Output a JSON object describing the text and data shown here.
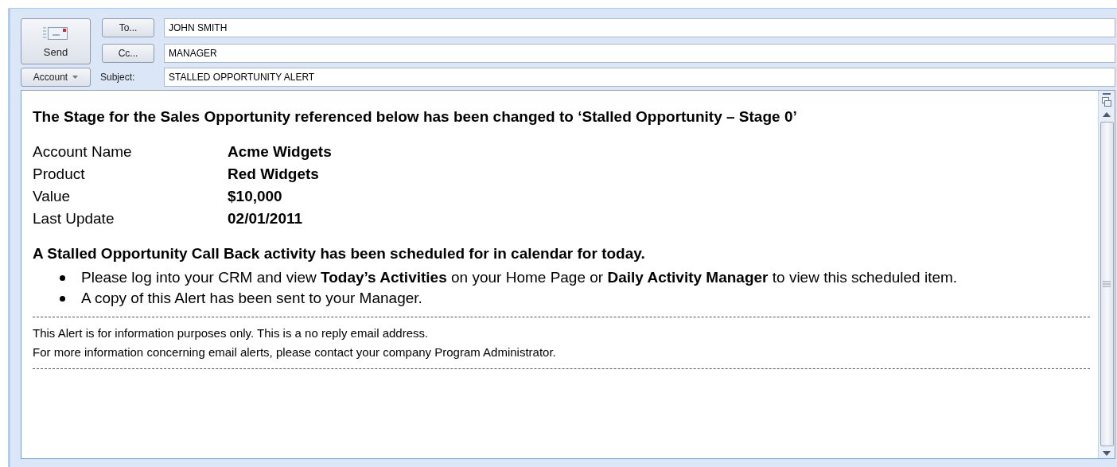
{
  "header": {
    "send": {
      "label": "Send"
    },
    "to": {
      "button": "To...",
      "value": "JOHN SMITH"
    },
    "cc": {
      "button": "Cc...",
      "value": "MANAGER"
    },
    "account": {
      "button": "Account"
    },
    "subject": {
      "label": "Subject:",
      "value": "STALLED OPPORTUNITY ALERT"
    }
  },
  "body": {
    "heading": "The Stage for the Sales Opportunity referenced below has been changed to ‘Stalled Opportunity – Stage 0’",
    "details": [
      {
        "label": "Account Name",
        "value": "Acme Widgets"
      },
      {
        "label": "Product",
        "value": "Red Widgets"
      },
      {
        "label": "Value",
        "value": "$10,000"
      },
      {
        "label": "Last Update",
        "value": "02/01/2011"
      }
    ],
    "activity_heading": "A Stalled Opportunity Call Back activity has been scheduled for in calendar for today.",
    "bullets": [
      "Please log into your CRM and view **Today’s Activities** on your Home Page or **Daily Activity Manager** to view this scheduled item.",
      "A copy of this Alert has been sent to your Manager."
    ],
    "footer": [
      "This Alert is for information purposes only. This is a no reply email address.",
      "For more information concerning email alerts, please contact your company Program Administrator."
    ]
  }
}
